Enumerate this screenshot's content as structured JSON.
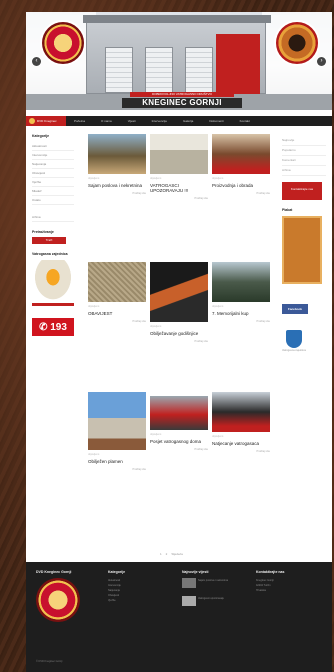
{
  "hero": {
    "subtitle": "DOBROVOLJNO VATROGASNO DRUŠTVO",
    "title": "KNEGINEC GORNJI",
    "prev_icon": "chevron-left-icon",
    "next_icon": "chevron-right-icon"
  },
  "nav": {
    "logo_label": "DVD Kneginec",
    "items": [
      "Početna",
      "O nama",
      "Vijesti",
      "Intervencije",
      "Galerija",
      "Dokumenti",
      "Kontakt"
    ]
  },
  "sidebar": {
    "title": "Kategorije",
    "items": [
      "Aktualnosti",
      "Intervencije",
      "Natjecanja",
      "Obavijesti",
      "Vježbe",
      "Mladež",
      "Ostalo"
    ],
    "extra": "Arhiva",
    "search_title": "Pretraživanje",
    "search_button": "Traži",
    "vatrogasci_title": "Vatrogasna zajednica",
    "emergency_number": "193"
  },
  "posts": [
    {
      "title": "Sajam poslova i nekretnina",
      "meta": "objavljeno",
      "excerpt": "",
      "more": "Pročitaj više"
    },
    {
      "title": "VATROGASCI UPOZORAVAJU !!!",
      "meta": "objavljeno",
      "excerpt": "",
      "more": "Pročitaj više"
    },
    {
      "title": "Proizvodnja i obrada",
      "meta": "objavljeno",
      "excerpt": "",
      "more": "Pročitaj više"
    },
    {
      "title": "OBAVIJEST",
      "meta": "objavljeno",
      "excerpt": "",
      "more": "Pročitaj više"
    },
    {
      "title": "Obilježavanje godišnjice",
      "meta": "objavljeno",
      "excerpt": "",
      "more": "Pročitaj više"
    },
    {
      "title": "7. Memorijalni kup",
      "meta": "objavljeno",
      "excerpt": "",
      "more": "Pročitaj više"
    },
    {
      "title": "Obilježen plamen",
      "meta": "objavljeno",
      "excerpt": "",
      "more": "Pročitaj više"
    },
    {
      "title": "Posjet vatrogasnog doma",
      "meta": "objavljeno",
      "excerpt": "",
      "more": "Pročitaj više"
    },
    {
      "title": "Natjecanje vatrogasaca",
      "meta": "objavljeno",
      "excerpt": "",
      "more": "Pročitaj više"
    }
  ],
  "right_sidebar": {
    "items": [
      "Najnovije",
      "Popularno",
      "Komentari",
      "Arhiva"
    ],
    "donate_button": "Kontaktirajte nas",
    "poster_title": "Plakat",
    "facebook": "Facebook",
    "shield_label": "Vatrogasna zajednica"
  },
  "pagination": [
    "1",
    "2",
    "Sljedeća"
  ],
  "footer": {
    "col1_title": "DVD Kneginec Gornji",
    "col2_title": "Kategorije",
    "col2_items": [
      "Aktualnosti",
      "Intervencije",
      "Natjecanja",
      "Obavijesti",
      "Vježbe"
    ],
    "col3_title": "Najnovije vijesti",
    "col3_items": [
      "Sajam poslova i nekretnina",
      "Vatrogasci upozoravaju"
    ],
    "col4_title": "Kontaktirajte nas",
    "col4_items": [
      "Kneginec Gornji",
      "42204 Turčin",
      "Hrvatska"
    ],
    "copyright": "© DVD Kneginec Gornji"
  }
}
